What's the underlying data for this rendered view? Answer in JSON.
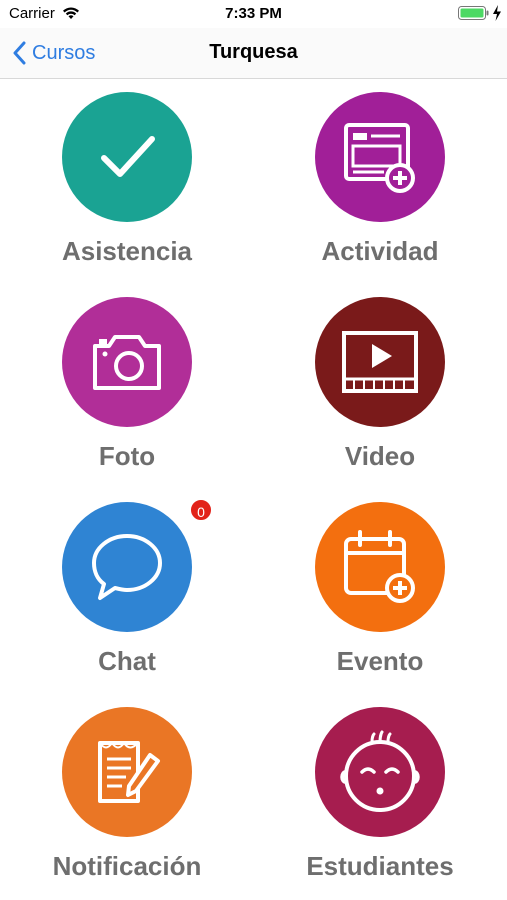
{
  "status": {
    "carrier": "Carrier",
    "time": "7:33 PM"
  },
  "nav": {
    "back_label": "Cursos",
    "title": "Turquesa"
  },
  "tiles": [
    {
      "label": "Asistencia",
      "icon": "checkmark-icon",
      "color": "#1aa393"
    },
    {
      "label": "Actividad",
      "icon": "add-activity-icon",
      "color": "#a11f98"
    },
    {
      "label": "Foto",
      "icon": "camera-icon",
      "color": "#b12e98"
    },
    {
      "label": "Video",
      "icon": "video-play-icon",
      "color": "#7a1a1a"
    },
    {
      "label": "Chat",
      "icon": "chat-bubble-icon",
      "color": "#2f84d3",
      "badge": "0"
    },
    {
      "label": "Evento",
      "icon": "calendar-add-icon",
      "color": "#f36f0f"
    },
    {
      "label": "Notificación",
      "icon": "note-pencil-icon",
      "color": "#ea7625"
    },
    {
      "label": "Estudiantes",
      "icon": "baby-face-icon",
      "color": "#a61d4f"
    }
  ],
  "colors": {
    "accent": "#2f7de1",
    "label": "#6e6e6e",
    "badge": "#e2231a"
  }
}
